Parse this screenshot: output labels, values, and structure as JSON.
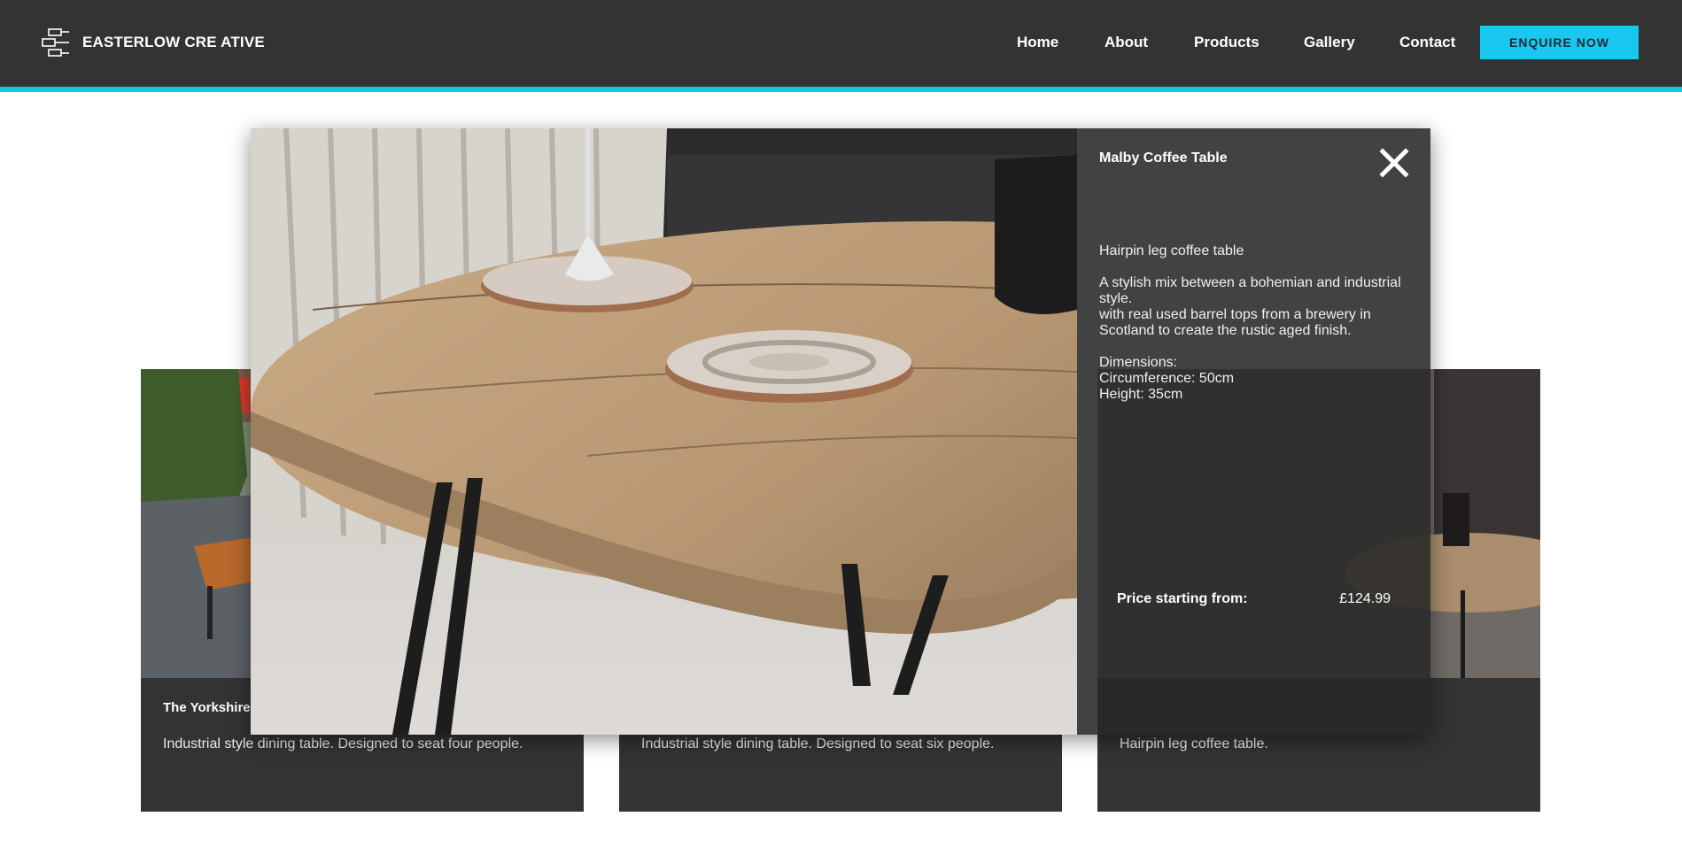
{
  "brand": {
    "name": "EASTERLOW CRE ATIVE",
    "logo_icon": "logo-mark-icon"
  },
  "nav": {
    "items": [
      {
        "label": "Home"
      },
      {
        "label": "About"
      },
      {
        "label": "Products"
      },
      {
        "label": "Gallery"
      },
      {
        "label": "Contact"
      }
    ],
    "cta_label": "ENQUIRE NOW"
  },
  "colors": {
    "header": "#333333",
    "accent": "#19c7f0",
    "panel": "#282828"
  },
  "cards": [
    {
      "title": "The Yorkshire",
      "description": "Industrial style dining table. Designed to seat four people."
    },
    {
      "title": "",
      "description": "Industrial style dining table. Designed to seat six people."
    },
    {
      "title": "",
      "description": "Hairpin leg coffee table."
    }
  ],
  "modal": {
    "title": "Malby Coffee Table",
    "close_icon": "close-icon",
    "subtitle": "Hairpin leg coffee table",
    "description_line1": "A stylish mix between a bohemian and industrial style.",
    "description_line2": "with real used barrel tops from a brewery in Scotland to create the rustic aged finish.",
    "dimensions_label": "Dimensions:",
    "circumference": "Circumference: 50cm",
    "height": "Height: 35cm",
    "price_label": "Price starting from:",
    "price_value": "£124.99"
  }
}
